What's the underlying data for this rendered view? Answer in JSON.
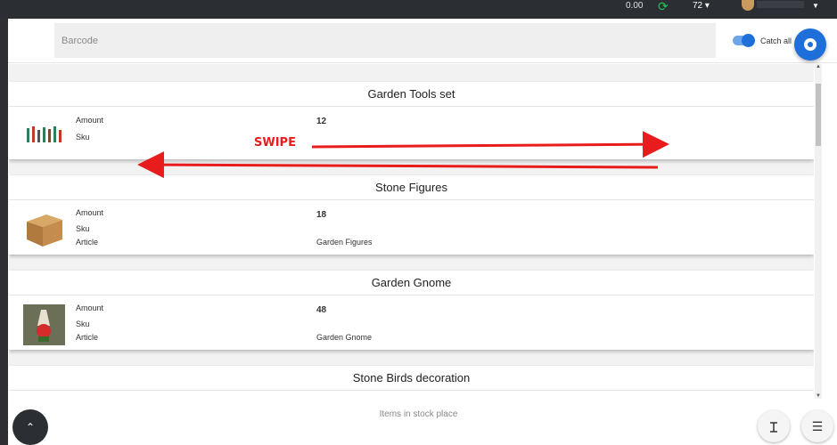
{
  "topbar": {
    "amount": "0.00",
    "refresh_icon": "refresh-icon",
    "count": "72 ▾",
    "caret": "▼"
  },
  "search": {
    "placeholder": "Barcode",
    "catch_all_label": "Catch all",
    "catch_all_on": true
  },
  "cards": [
    {
      "title": "Garden Tools set",
      "amount_label": "Amount",
      "amount": "12",
      "sku_label": "Sku",
      "sku": "",
      "article_label": "",
      "article": ""
    },
    {
      "title": "Stone Figures",
      "amount_label": "Amount",
      "amount": "18",
      "sku_label": "Sku",
      "sku": "",
      "article_label": "Article",
      "article": "Garden Figures"
    },
    {
      "title": "Garden Gnome",
      "amount_label": "Amount",
      "amount": "48",
      "sku_label": "Sku",
      "sku": "",
      "article_label": "Article",
      "article": "Garden Gnome"
    },
    {
      "title": "Stone Birds decoration"
    }
  ],
  "annotation": {
    "swipe": "SWIPE",
    "color": "#e81c1c"
  },
  "footer": {
    "status": "Items in stock place"
  },
  "colors": {
    "accent": "#1e6fd9",
    "dark": "#2b2e33"
  }
}
